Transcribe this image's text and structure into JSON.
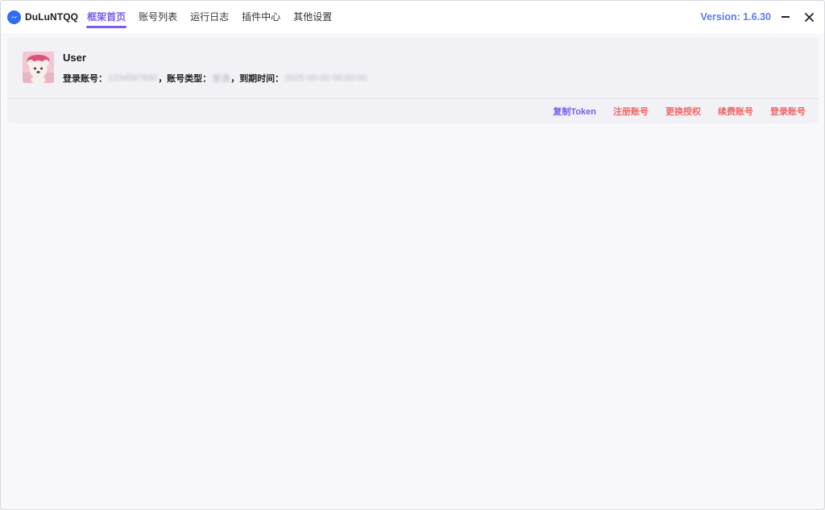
{
  "app": {
    "name": "DuLuNTQQ",
    "version": "Version: 1.6.30"
  },
  "tabs": [
    {
      "label": "框架首页",
      "active": true
    },
    {
      "label": "账号列表",
      "active": false
    },
    {
      "label": "运行日志",
      "active": false
    },
    {
      "label": "插件中心",
      "active": false
    },
    {
      "label": "其他设置",
      "active": false
    }
  ],
  "user": {
    "name": "User",
    "account_label": "登录账号：",
    "account_value": "1234567890",
    "type_label": "，账号类型：",
    "type_value": "普通",
    "expire_label": "，到期时间：",
    "expire_value": "2025-00-00 00:00:00"
  },
  "actions": {
    "copy_token": "复制Token",
    "register": "注册账号",
    "change_auth": "更换授权",
    "renew": "续费账号",
    "login": "登录账号"
  },
  "colors": {
    "accent": "#7c5cf0",
    "version": "#5b7cf2",
    "danger": "#f06666",
    "brand": "#2f6bf5"
  },
  "icons": {
    "brand": "messenger-logo-icon",
    "minimize": "minimize-icon",
    "close": "close-icon"
  }
}
